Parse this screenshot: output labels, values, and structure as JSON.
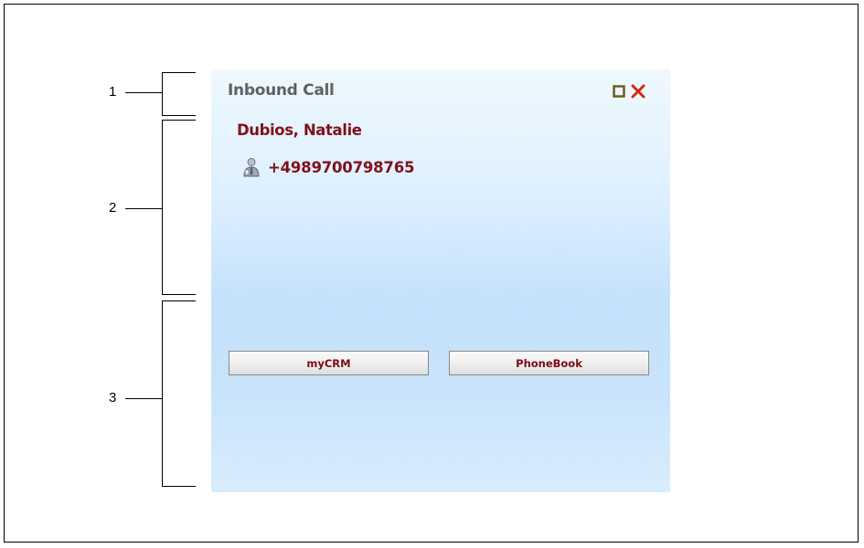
{
  "annotations": {
    "label_1": "1",
    "label_2": "2",
    "label_3": "3"
  },
  "popup": {
    "title": "Inbound Call",
    "caller_name": "Dubios, Natalie",
    "phone_number": "+4989700798765",
    "maximize_icon": "maximize-icon",
    "close_icon": "close-icon",
    "contact_icon": "contact-person-icon"
  },
  "buttons": {
    "mycrm_label": "myCRM",
    "phonebook_label": "PhoneBook"
  },
  "colors": {
    "accent_text": "#7c0a13",
    "title_text": "#5b5b5b",
    "close_red": "#d62a12",
    "maximize_olive": "#6b5a14"
  }
}
